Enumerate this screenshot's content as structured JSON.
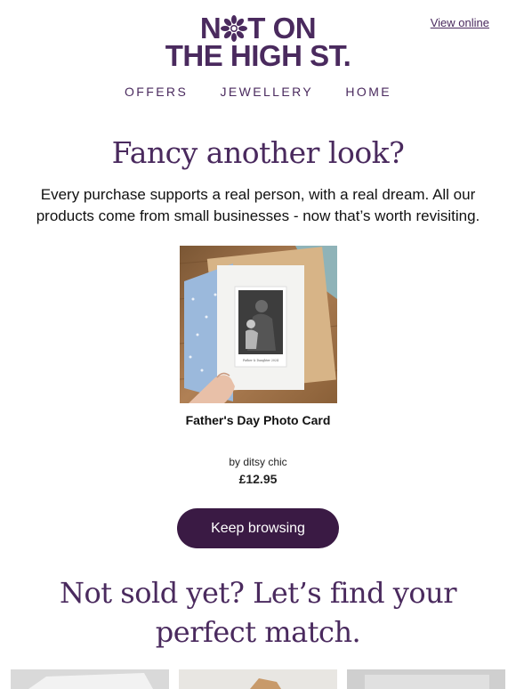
{
  "header": {
    "view_online": "View online",
    "logo_line1_a": "N",
    "logo_line1_b": "T ON",
    "logo_line2": "THE HIGH ST."
  },
  "nav": {
    "items": [
      "OFFERS",
      "JEWELLERY",
      "HOME"
    ]
  },
  "hero": {
    "headline": "Fancy another look?",
    "subtext": "Every purchase supports a real person, with a real dream. All our products come from small businesses - now that’s worth revisiting."
  },
  "product": {
    "name": "Father's Day Photo Card",
    "by": "by ditsy chic",
    "price": "£12.95",
    "card_caption": "Father & Daughter 2024"
  },
  "cta": {
    "label": "Keep browsing"
  },
  "section2": {
    "headline": "Not sold yet? Let’s find your perfect match."
  },
  "colors": {
    "brand": "#4a2a5e",
    "button": "#3a1a44"
  }
}
